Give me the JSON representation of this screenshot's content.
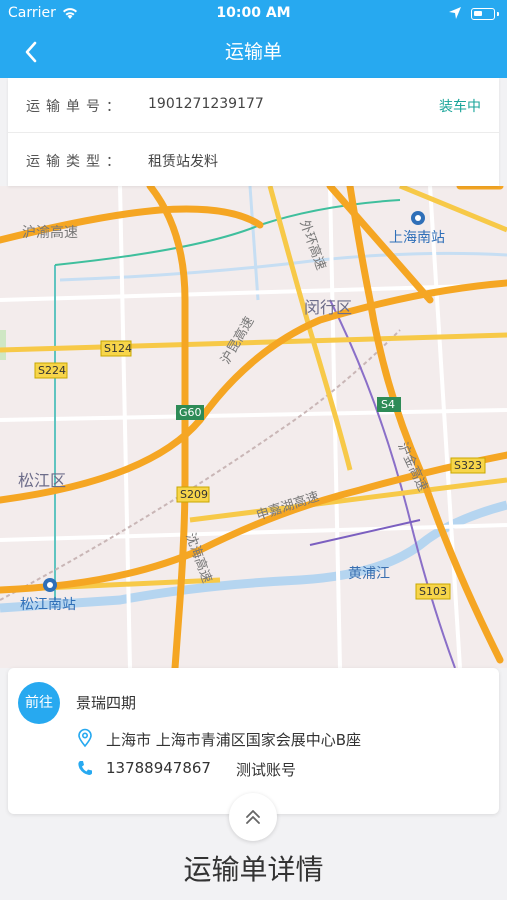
{
  "status_bar": {
    "carrier": "Carrier",
    "time": "10:00 AM"
  },
  "nav": {
    "title": "运输单",
    "back_icon": "chevron-left-icon"
  },
  "order": {
    "number_label": "运输单号：",
    "number_value": "1901271239177",
    "status": "装车中",
    "type_label": "运输类型：",
    "type_value": "租赁站发料"
  },
  "map": {
    "labels": {
      "huyu": "沪渝高速",
      "waihuan": "外环高速",
      "shanghai_south": "上海南站",
      "minhang": "闵行区",
      "s124": "S124",
      "hukun": "沪昆高速",
      "s224": "S224",
      "g60": "G60",
      "s4": "S4",
      "songjiang": "松江区",
      "hujin": "沪金高速",
      "s323": "S323",
      "s209": "S209",
      "shenjiahu": "申嘉湖高速",
      "shenhai": "沈海高速",
      "huangpu": "黄浦江",
      "songjiang_south": "松江南站",
      "s103": "S103"
    },
    "colors": {
      "expressway": "#f5a623",
      "road": "#f7c948",
      "water": "#b5d5f0",
      "land": "#f3ecec"
    }
  },
  "destination": {
    "go_label": "前往",
    "name": "景瑞四期",
    "address": "上海市 上海市青浦区国家会展中心B座",
    "phone": "13788947867",
    "account": "测试账号"
  },
  "detail_title": "运输单详情",
  "colors": {
    "primary": "#27a9f0",
    "status": "#1aa59a"
  }
}
